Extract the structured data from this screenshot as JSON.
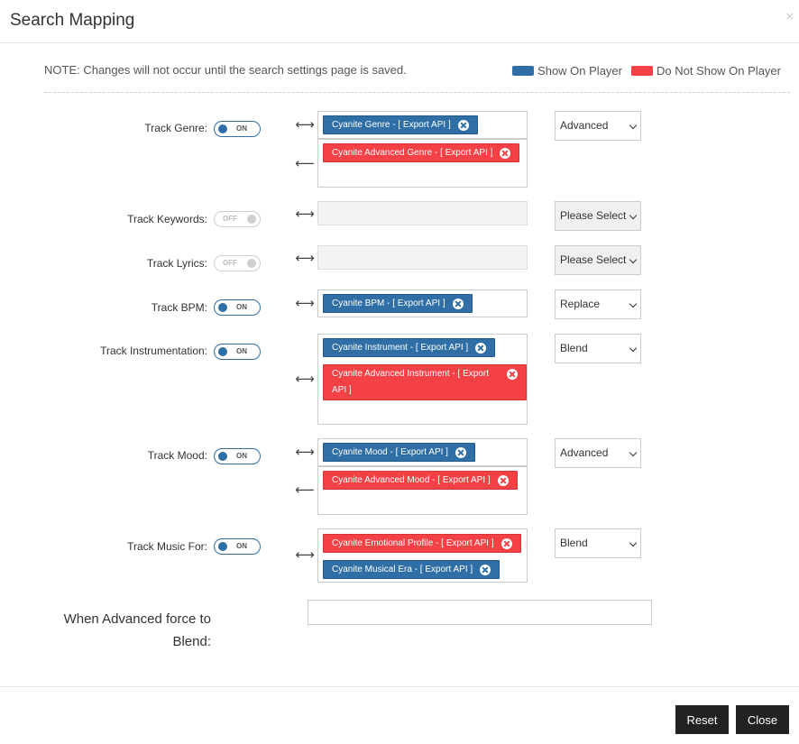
{
  "modal": {
    "title": "Search Mapping",
    "close_glyph": "×",
    "note": "NOTE: Changes will not occur until the search settings page is saved.",
    "legend": {
      "show": {
        "label": "Show On Player",
        "color": "#2f6fa5"
      },
      "hide": {
        "label": "Do Not Show On Player",
        "color": "#f44146"
      }
    }
  },
  "rows": {
    "genre": {
      "label": "Track Genre:",
      "toggle": "ON",
      "show_tags": [
        {
          "text": "Cyanite Genre - [ Export API ]"
        }
      ],
      "hide_tags": [
        {
          "text": "Cyanite Advanced Genre - [ Export API ]"
        }
      ],
      "select": "Advanced"
    },
    "keywords": {
      "label": "Track Keywords:",
      "toggle": "OFF",
      "select": "Please Select"
    },
    "lyrics": {
      "label": "Track Lyrics:",
      "toggle": "OFF",
      "select": "Please Select"
    },
    "bpm": {
      "label": "Track BPM:",
      "toggle": "ON",
      "show_tags": [
        {
          "text": "Cyanite BPM - [ Export API ]"
        }
      ],
      "select": "Replace"
    },
    "instrumentation": {
      "label": "Track Instrumentation:",
      "toggle": "ON",
      "show_tags": [
        {
          "text": "Cyanite Instrument - [ Export API ]"
        }
      ],
      "hide_tags": [
        {
          "text": "Cyanite Advanced Instrument - [ Export API ]"
        }
      ],
      "select": "Blend"
    },
    "mood": {
      "label": "Track Mood:",
      "toggle": "ON",
      "show_tags": [
        {
          "text": "Cyanite Mood - [ Export API ]"
        }
      ],
      "hide_tags": [
        {
          "text": "Cyanite Advanced Mood - [ Export API ]"
        }
      ],
      "select": "Advanced"
    },
    "musicfor": {
      "label": "Track Music For:",
      "toggle": "ON",
      "tags": [
        {
          "text": "Cyanite Emotional Profile - [ Export API ]",
          "color": "red"
        },
        {
          "text": "Cyanite Musical Era - [ Export API ]",
          "color": "blue"
        }
      ],
      "select": "Blend"
    }
  },
  "icons": {
    "both_arrow": "⟷",
    "left_arrow": "⟵"
  },
  "advanced": {
    "label": "When Advanced force to Blend:",
    "value": ""
  },
  "footer": {
    "reset_label": "Reset",
    "close_label": "Close"
  }
}
